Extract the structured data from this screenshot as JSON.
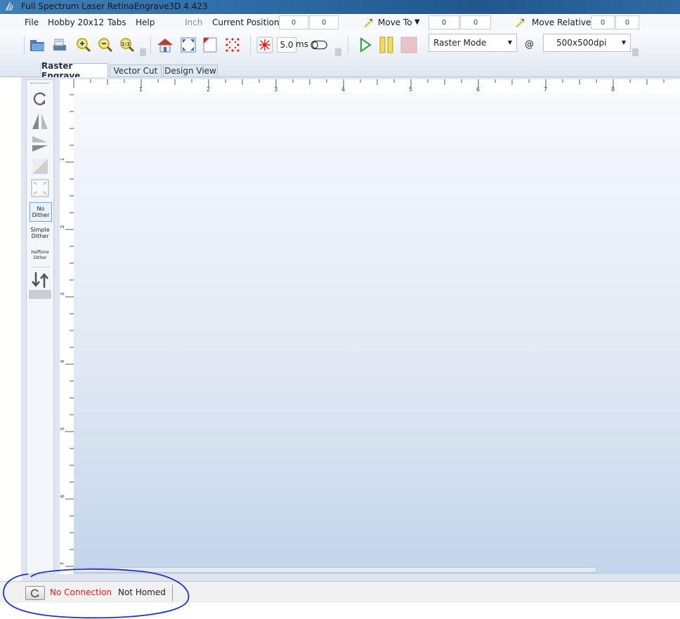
{
  "window": {
    "title": "Full Spectrum Laser RetinaEngrave3D 4.423"
  },
  "menu": {
    "items": [
      "File",
      "Hobby 20x12",
      "Tabs",
      "Help"
    ],
    "unit_label": "Inch",
    "current_position_label": "Current Position:",
    "current_x": "0",
    "current_y": "0",
    "move_to_label": "Move To",
    "move_to_x": "0",
    "move_to_y": "0",
    "move_relative_label": "Move Relative",
    "move_rel_x": "0",
    "move_rel_y": "0"
  },
  "toolbar": {
    "pulse_value": "5.0",
    "pulse_unit": "ms",
    "mode_value": "Raster Mode",
    "at_symbol": "@",
    "dpi_value": "500x500dpi"
  },
  "tabs": [
    {
      "label": "Raster Engrave",
      "active": true
    },
    {
      "label": "Vector Cut",
      "active": false
    },
    {
      "label": "Design View",
      "active": false
    }
  ],
  "side_tools": {
    "no_dither_1": "No",
    "no_dither_2": "Dither",
    "simple_dither_1": "Simple",
    "simple_dither_2": "Dither",
    "halftone_dither_1": "Halftone",
    "halftone_dither_2": "Dither"
  },
  "rulers": {
    "horizontal_labels": [
      "1",
      "2",
      "3",
      "4",
      "5",
      "6",
      "7",
      "8"
    ],
    "vertical_labels": [
      "1",
      "2",
      "3",
      "4",
      "5",
      "6",
      "7"
    ]
  },
  "status": {
    "connection": "No Connection",
    "homed": "Not Homed"
  },
  "colors": {
    "connection_text": "#d02020",
    "annotation_stroke": "#1f2fd8"
  },
  "icons": [
    "app-logo-icon",
    "open-folder-icon",
    "scanner-icon",
    "zoom-in-icon",
    "zoom-out-icon",
    "zoom-actual-icon",
    "home-icon",
    "fit-screen-icon",
    "page-corner-icon",
    "dot-grid-icon",
    "laser-burst-icon",
    "toggle-switch-icon",
    "play-icon",
    "pause-icon",
    "stop-icon",
    "rotate-icon",
    "mirror-horizontal-icon",
    "mirror-vertical-icon",
    "diagonal-icon",
    "expand-icon",
    "sort-arrows-icon",
    "reset-icon"
  ]
}
